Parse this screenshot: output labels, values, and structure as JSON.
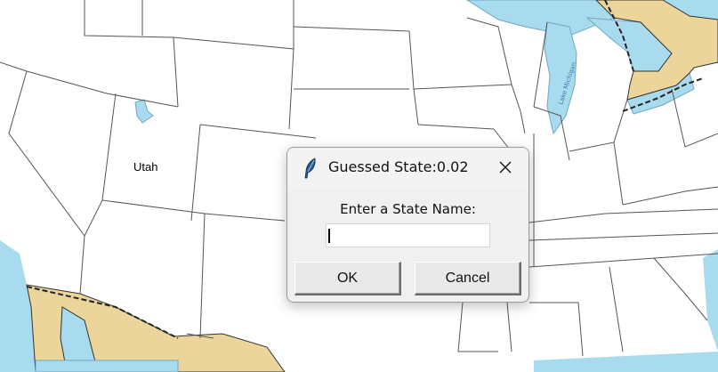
{
  "map": {
    "state_label": "Utah",
    "lake_labels": [
      "Lake Michigan"
    ],
    "colors": {
      "water": "#a9dbef",
      "canada": "#ecd59b",
      "mexico": "#ecd59b",
      "land": "#ffffff",
      "border": "#555555"
    }
  },
  "dialog": {
    "title": "Guessed State:0.02",
    "prompt": "Enter a State Name:",
    "input_value": "",
    "ok_label": "OK",
    "cancel_label": "Cancel",
    "title_icon": "feather-icon",
    "close_icon": "close-icon"
  }
}
